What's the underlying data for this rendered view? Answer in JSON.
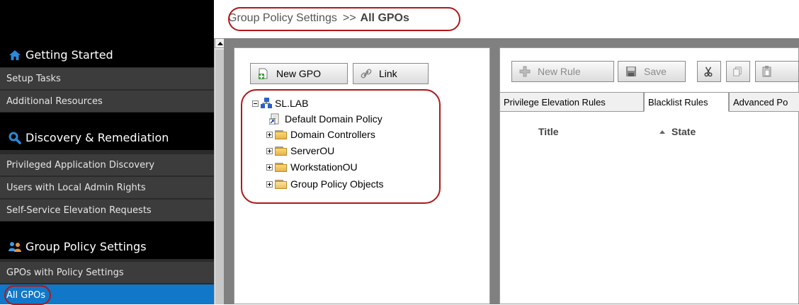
{
  "breadcrumb": {
    "path": "Group Policy Settings",
    "separator": ">>",
    "current": "All GPOs"
  },
  "sidebar": {
    "sections": [
      {
        "title": "Getting Started",
        "icon": "home-icon",
        "items": [
          "Setup Tasks",
          "Additional Resources"
        ]
      },
      {
        "title": "Discovery & Remediation",
        "icon": "search-icon",
        "items": [
          "Privileged Application Discovery",
          "Users with Local Admin Rights",
          "Self-Service Elevation Requests"
        ]
      },
      {
        "title": "Group Policy Settings",
        "icon": "users-icon",
        "items": [
          "GPOs with Policy Settings",
          "All GPOs"
        ]
      }
    ],
    "active_item": "All GPOs"
  },
  "gpo_toolbar": {
    "new_gpo": "New GPO",
    "link": "Link"
  },
  "tree": {
    "root": "SL.LAB",
    "children": [
      "Default Domain Policy",
      "Domain Controllers",
      "ServerOU",
      "WorkstationOU",
      "Group Policy Objects"
    ]
  },
  "rules_toolbar": {
    "new_rule": "New Rule",
    "save": "Save"
  },
  "tabs": [
    "Privilege Elevation Rules",
    "Blacklist Rules",
    "Advanced Po"
  ],
  "active_tab": "Blacklist Rules",
  "columns": {
    "title": "Title",
    "state": "State"
  },
  "colors": {
    "highlight": "#1177c8",
    "annotation": "#b01818",
    "sidebar_bg": "#2b2b2b"
  }
}
